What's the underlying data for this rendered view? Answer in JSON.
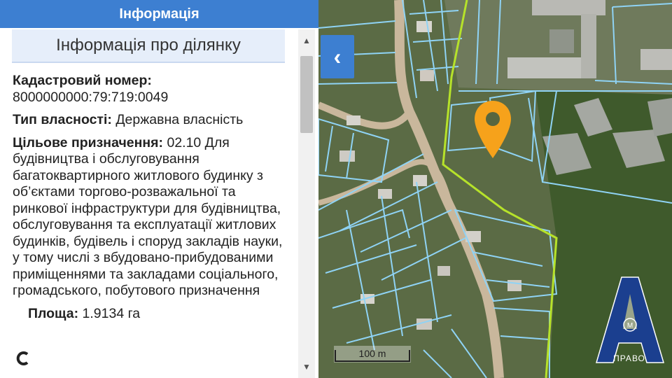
{
  "panel": {
    "header_title": "Інформація",
    "section_title": "Інформація про ділянку",
    "cadastral_label": "Кадастровий номер:",
    "cadastral_value": "8000000000:79:719:0049",
    "ownership_label": "Тип власності:",
    "ownership_value": "Державна власність",
    "purpose_label": "Цільове призначення:",
    "purpose_value": "02.10 Для будівництва і обслуговування багатоквартирного житлового будинку з об’єктами торгово-розважальної та ринкової інфраструктури для будівництва, обслуговування та експлуатації житлових будинків, будівель і споруд закладів науки, у тому числі з вбудовано-прибудованими приміщеннями та закладами соціального, громадського, побутового призначення",
    "area_label": "Площа:",
    "area_value": "1.9134 га"
  },
  "scrollbar": {
    "up_arrow": "▲",
    "down_arrow": "▼"
  },
  "map": {
    "collapse_glyph": "‹",
    "scale_label": "100 m"
  },
  "brand": {
    "letter": "А",
    "mark": "М",
    "text": "ПРАВО"
  },
  "colors": {
    "header_blue": "#3d7fd1",
    "parcel_line": "#8fd3f5",
    "boundary_green": "#b6e22a",
    "marker_orange": "#f6a21b",
    "brand_blue": "#1b3f8f"
  }
}
